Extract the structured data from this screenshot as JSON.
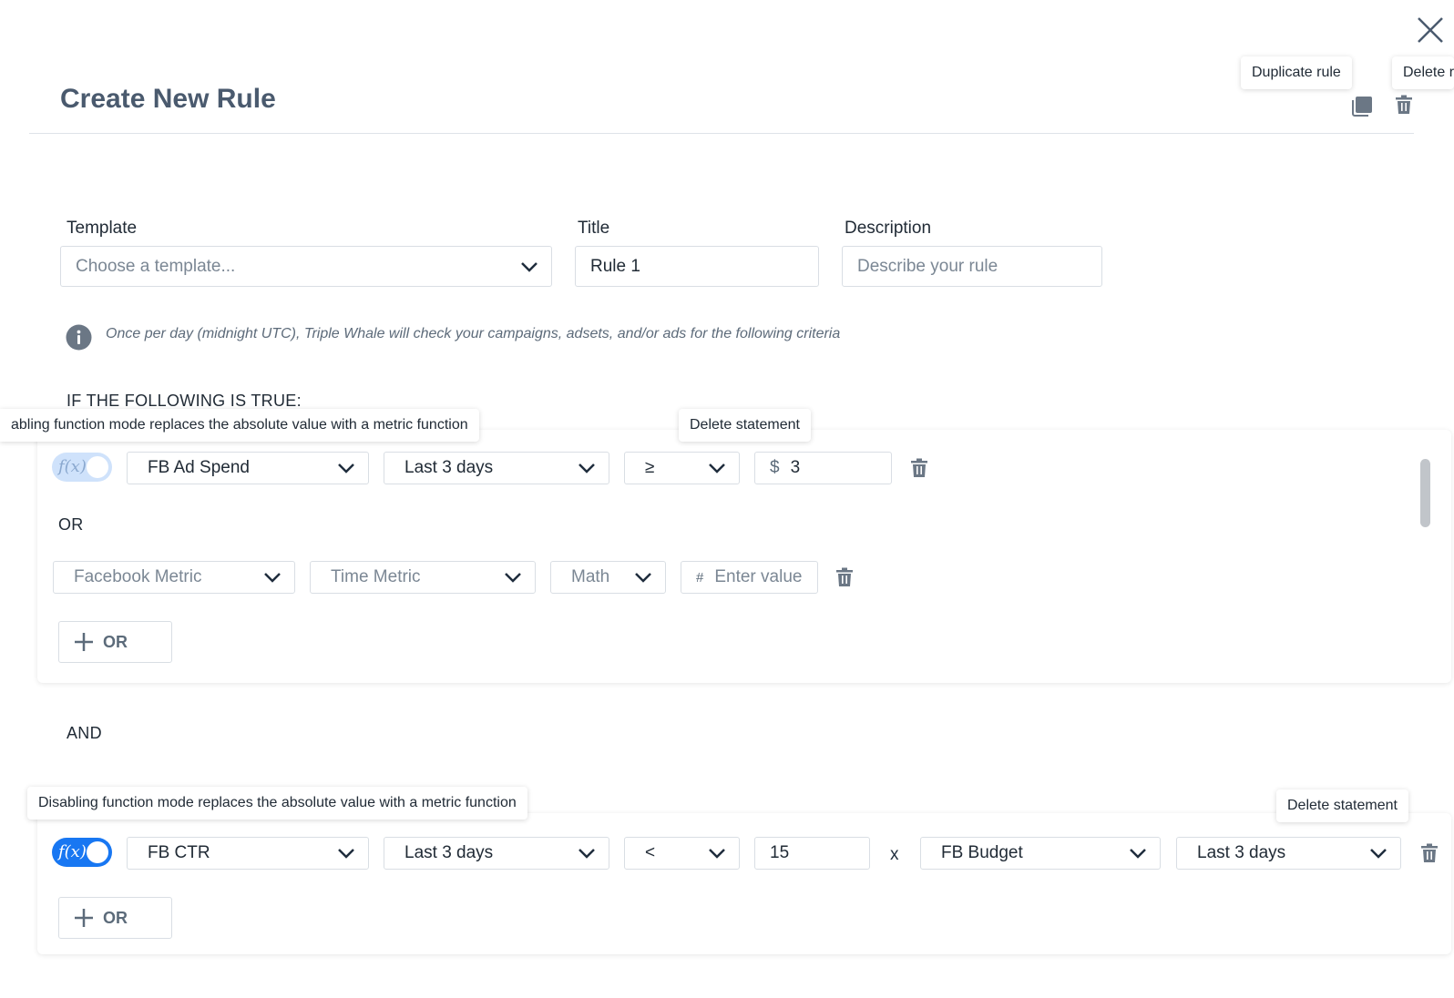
{
  "header": {
    "title": "Create New Rule",
    "duplicate_tooltip": "Duplicate rule",
    "delete_tooltip": "Delete r"
  },
  "form": {
    "template_label": "Template",
    "template_placeholder": "Choose a template...",
    "title_label": "Title",
    "title_value": "Rule 1",
    "description_label": "Description",
    "description_placeholder": "Describe your rule"
  },
  "info": {
    "text": "Once per day (midnight UTC), Triple Whale will check your campaigns, adsets, and/or ads for the following criteria"
  },
  "conditions": {
    "heading": "IF THE FOLLOWING IS TRUE:",
    "or_label": "OR",
    "and_label": "AND",
    "add_or_label": "OR",
    "function_tooltip_1": "abling function mode replaces the absolute value with a metric function",
    "function_tooltip_2": "Disabling function mode replaces the absolute value with a metric function",
    "delete_statement_tooltip": "Delete statement",
    "fx_label": "f(x)",
    "group1": {
      "statement1": {
        "metric": "FB Ad Spend",
        "time": "Last 3 days",
        "operator": "≥",
        "value_prefix": "$",
        "value": "3"
      },
      "statement2": {
        "metric_placeholder": "Facebook Metric",
        "time_placeholder": "Time Metric",
        "operator_placeholder": "Math",
        "value_prefix": "#",
        "value_placeholder": "Enter value"
      }
    },
    "group2": {
      "statement1": {
        "metric": "FB CTR",
        "time": "Last 3 days",
        "operator": "<",
        "value": "15",
        "multiplier": "x",
        "function_metric": "FB Budget",
        "function_time": "Last 3 days"
      }
    }
  },
  "colors": {
    "accent": "#1877f2",
    "title": "#4a5a6e",
    "icon": "#6b7785"
  }
}
